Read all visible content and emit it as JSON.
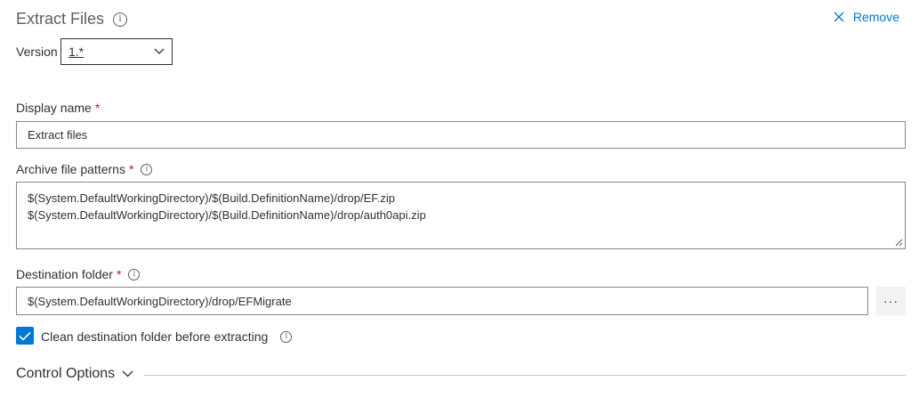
{
  "header": {
    "title": "Extract Files",
    "remove_label": "Remove"
  },
  "version": {
    "label": "Version",
    "selected": "1.*"
  },
  "display_name": {
    "label": "Display name",
    "required_mark": "*",
    "value": "Extract files"
  },
  "archive_patterns": {
    "label": "Archive file patterns",
    "required_mark": "*",
    "lines": [
      "$(System.DefaultWorkingDirectory)/$(Build.DefinitionName)/drop/EF.zip",
      "$(System.DefaultWorkingDirectory)/$(Build.DefinitionName)/drop/auth0api.zip"
    ]
  },
  "destination": {
    "label": "Destination folder",
    "required_mark": "*",
    "value": "$(System.DefaultWorkingDirectory)/drop/EFMigrate",
    "browse_label": "···"
  },
  "clean_checkbox": {
    "label": "Clean destination folder before extracting",
    "checked": true
  },
  "control_options": {
    "label": "Control Options"
  },
  "colors": {
    "accent": "#0078d4",
    "required": "#a4262c",
    "border": "#8a8886"
  },
  "icons": [
    "info-icon",
    "close-icon",
    "chevron-down-icon",
    "checkmark-icon",
    "ellipsis-icon",
    "resize-grip-icon"
  ]
}
